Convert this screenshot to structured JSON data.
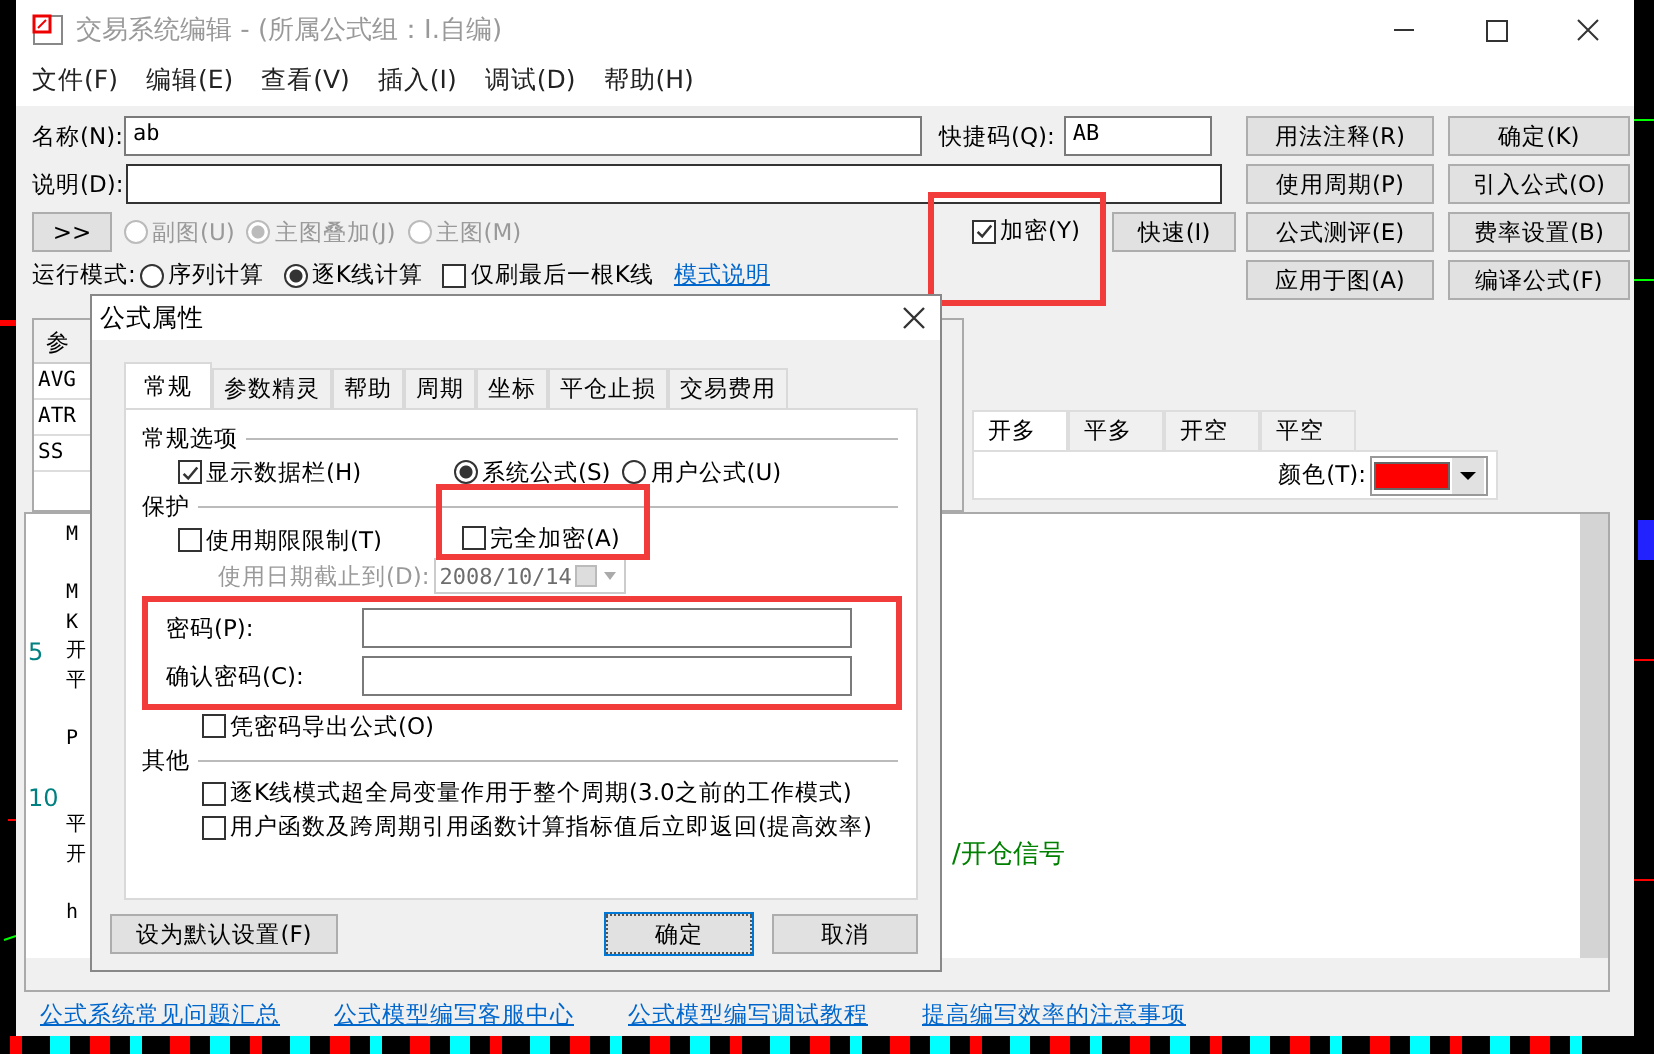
{
  "window": {
    "title": "交易系统编辑 - (所属公式组：I.自编)"
  },
  "menu": [
    "文件(F)",
    "编辑(E)",
    "查看(V)",
    "插入(I)",
    "调试(D)",
    "帮助(H)"
  ],
  "name_field": {
    "label": "名称(N):",
    "value": "ab"
  },
  "shortcut_field": {
    "label": "快捷码(Q):",
    "value": "AB"
  },
  "description_field": {
    "label": "说明(D):"
  },
  "expand_button": ">>",
  "chart_radios": [
    {
      "label": "副图(U)",
      "selected": false,
      "disabled": true
    },
    {
      "label": "主图叠加(J)",
      "selected": true,
      "disabled": true
    },
    {
      "label": "主图(M)",
      "selected": false,
      "disabled": true
    }
  ],
  "encrypt": {
    "label": "加密(Y)",
    "checked": true,
    "highlighted": true
  },
  "fast_button": "快速(I)",
  "run_mode": {
    "label": "运行模式:",
    "options": [
      {
        "label": "序列计算",
        "selected": false
      },
      {
        "label": "逐K线计算",
        "selected": true
      }
    ],
    "last_bar_only": {
      "label": "仅刷最后一根K线",
      "checked": false
    },
    "link": "模式说明"
  },
  "side_buttons": [
    "用法注释(R)",
    "确定(K)",
    "使用周期(P)",
    "引入公式(O)",
    "公式测评(E)",
    "费率设置(B)",
    "应用于图(A)",
    "编译公式(F)"
  ],
  "param_table": {
    "header": "参",
    "rows": [
      "AVG",
      "ATR",
      "SS"
    ]
  },
  "trade_tabs": [
    {
      "label": "开多",
      "selected": true
    },
    {
      "label": "平多",
      "selected": false
    },
    {
      "label": "开空",
      "selected": false
    },
    {
      "label": "平空",
      "selected": false
    }
  ],
  "color_picker": {
    "label": "颜色(T):",
    "color": "#ff0000"
  },
  "editor": {
    "lines": [
      {
        "kind": "code",
        "text": "M"
      },
      {
        "kind": "blank"
      },
      {
        "kind": "code",
        "text": "M"
      },
      {
        "kind": "code",
        "text": "K"
      },
      {
        "kind": "code",
        "number": "5",
        "text": "开"
      },
      {
        "kind": "code",
        "text": "平"
      },
      {
        "kind": "blank"
      },
      {
        "kind": "code",
        "text": "P"
      },
      {
        "kind": "blank"
      },
      {
        "kind": "code",
        "number": "10"
      },
      {
        "kind": "code",
        "text": "平"
      },
      {
        "kind": "code",
        "text": "开",
        "comment": "/开仓信号"
      },
      {
        "kind": "blank"
      },
      {
        "kind": "code",
        "text": "h"
      }
    ]
  },
  "links": [
    "公式系统常见问题汇总",
    "公式模型编写客服中心",
    "公式模型编写调试教程",
    "提高编写效率的注意事项"
  ],
  "dialog": {
    "title": "公式属性",
    "tabs": [
      {
        "label": "常规",
        "selected": true
      },
      {
        "label": "参数精灵",
        "selected": false
      },
      {
        "label": "帮助",
        "selected": false
      },
      {
        "label": "周期",
        "selected": false
      },
      {
        "label": "坐标",
        "selected": false
      },
      {
        "label": "平仓止损",
        "selected": false
      },
      {
        "label": "交易费用",
        "selected": false
      }
    ],
    "general_group": "常规选项",
    "show_data_bar": {
      "label": "显示数据栏(H)",
      "checked": true
    },
    "formula_type": [
      {
        "label": "系统公式(S)",
        "selected": true
      },
      {
        "label": "用户公式(U)",
        "selected": false
      }
    ],
    "protect_group": "保护",
    "time_limit": {
      "label": "使用期限限制(T)",
      "checked": false
    },
    "full_encrypt": {
      "label": "完全加密(A)",
      "checked": false,
      "highlighted": true
    },
    "expiry": {
      "label": "使用日期截止到(D):",
      "value": "2008/10/14",
      "disabled": true
    },
    "password": {
      "label": "密码(P):",
      "highlighted": true
    },
    "confirm_password": {
      "label": "确认密码(C):"
    },
    "export_with_password": {
      "label": "凭密码导出公式(O)",
      "checked": false
    },
    "other_group": "其他",
    "other_options": [
      {
        "label": "逐K线模式超全局变量作用于整个周期(3.0之前的工作模式)",
        "checked": false
      },
      {
        "label": "用户函数及跨周期引用函数计算指标值后立即返回(提高效率)",
        "checked": false
      }
    ],
    "default_button": "设为默认设置(F)",
    "ok_button": "确定",
    "cancel_button": "取消"
  }
}
